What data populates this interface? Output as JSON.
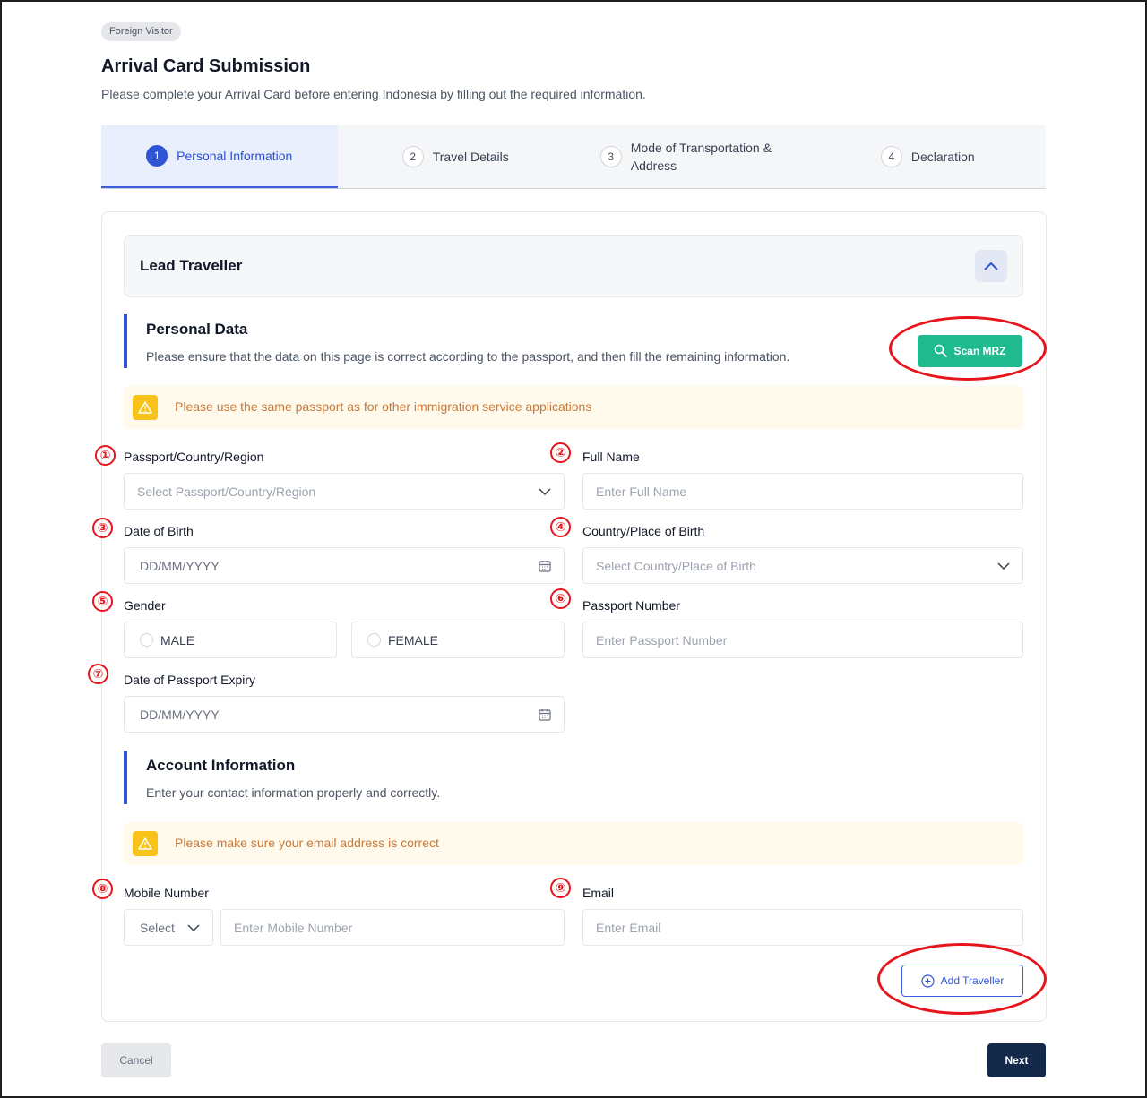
{
  "header": {
    "badge": "Foreign Visitor",
    "title": "Arrival Card Submission",
    "subtitle": "Please complete your Arrival Card before entering Indonesia by filling out the required information."
  },
  "steps": [
    {
      "number": "1",
      "label": "Personal Information",
      "active": true
    },
    {
      "number": "2",
      "label": "Travel Details",
      "active": false
    },
    {
      "number": "3",
      "label": "Mode of Transportation & Address",
      "active": false
    },
    {
      "number": "4",
      "label": "Declaration",
      "active": false
    }
  ],
  "lead": {
    "title": "Lead Traveller",
    "collapse_icon": "chevron-up-icon"
  },
  "personal": {
    "title": "Personal Data",
    "description": "Please ensure that the data on this page is correct according to the passport, and then fill the remaining information.",
    "scan_label": "Scan MRZ",
    "warning": "Please use the same passport as for other immigration service applications"
  },
  "fields": {
    "passport_country": {
      "marker": "①",
      "label": "Passport/Country/Region",
      "placeholder": "Select Passport/Country/Region"
    },
    "full_name": {
      "marker": "②",
      "label": "Full Name",
      "placeholder": "Enter Full Name"
    },
    "dob": {
      "marker": "③",
      "label": "Date of Birth",
      "placeholder": "DD/MM/YYYY"
    },
    "birth_place": {
      "marker": "④",
      "label": "Country/Place of Birth",
      "placeholder": "Select Country/Place of Birth"
    },
    "gender": {
      "marker": "⑤",
      "label": "Gender",
      "options": [
        "MALE",
        "FEMALE"
      ]
    },
    "passport_number": {
      "marker": "⑥",
      "label": "Passport Number",
      "placeholder": "Enter Passport Number"
    },
    "passport_expiry": {
      "marker": "⑦",
      "label": "Date of Passport Expiry",
      "placeholder": "DD/MM/YYYY"
    },
    "mobile": {
      "marker": "⑧",
      "label": "Mobile Number",
      "code_placeholder": "Select",
      "placeholder": "Enter Mobile Number"
    },
    "email": {
      "marker": "⑨",
      "label": "Email",
      "placeholder": "Enter Email"
    }
  },
  "account": {
    "title": "Account Information",
    "description": "Enter your contact information properly and correctly.",
    "warning": "Please make sure your email address is correct"
  },
  "actions": {
    "add_traveller": "Add Traveller",
    "cancel": "Cancel",
    "next": "Next"
  },
  "colors": {
    "accent": "#2f55d4",
    "scan": "#1fbb8e",
    "next": "#14284a",
    "annotation": "#e8141b",
    "warning_text": "#c9793a"
  }
}
